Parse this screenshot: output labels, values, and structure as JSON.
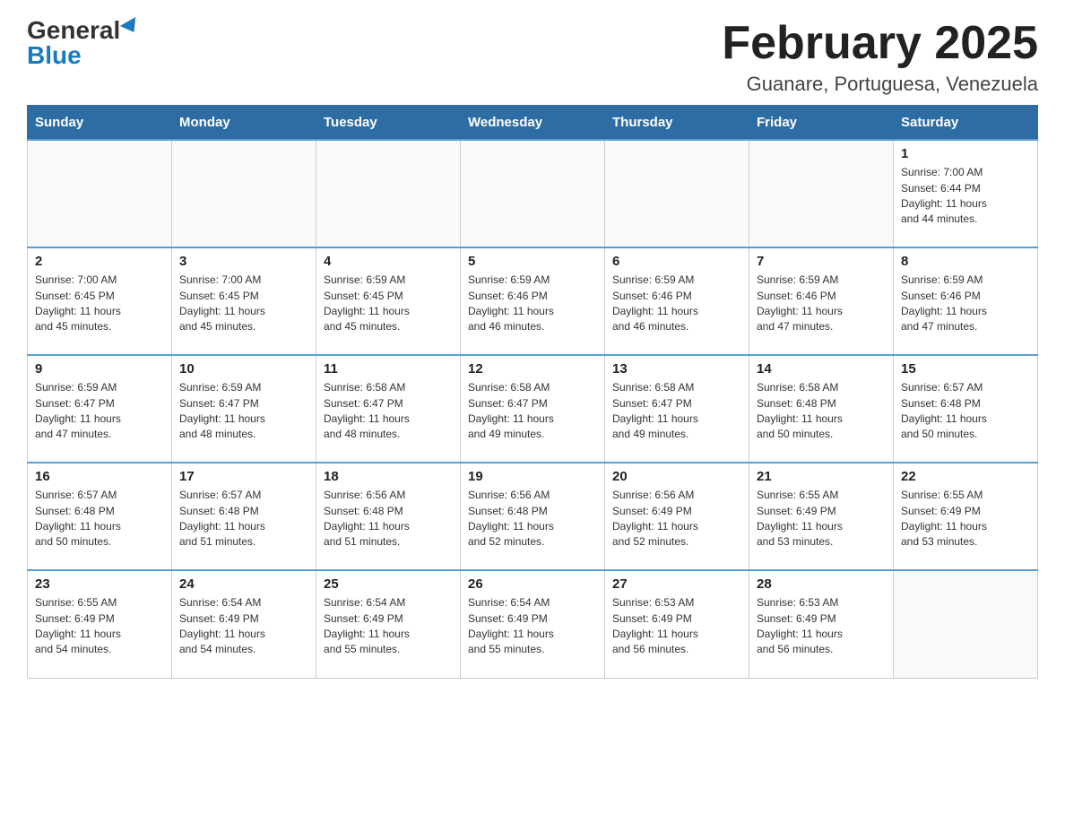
{
  "logo": {
    "general": "General",
    "blue": "Blue"
  },
  "header": {
    "month_title": "February 2025",
    "location": "Guanare, Portuguesa, Venezuela"
  },
  "weekdays": [
    "Sunday",
    "Monday",
    "Tuesday",
    "Wednesday",
    "Thursday",
    "Friday",
    "Saturday"
  ],
  "weeks": [
    [
      {
        "day": "",
        "info": ""
      },
      {
        "day": "",
        "info": ""
      },
      {
        "day": "",
        "info": ""
      },
      {
        "day": "",
        "info": ""
      },
      {
        "day": "",
        "info": ""
      },
      {
        "day": "",
        "info": ""
      },
      {
        "day": "1",
        "info": "Sunrise: 7:00 AM\nSunset: 6:44 PM\nDaylight: 11 hours\nand 44 minutes."
      }
    ],
    [
      {
        "day": "2",
        "info": "Sunrise: 7:00 AM\nSunset: 6:45 PM\nDaylight: 11 hours\nand 45 minutes."
      },
      {
        "day": "3",
        "info": "Sunrise: 7:00 AM\nSunset: 6:45 PM\nDaylight: 11 hours\nand 45 minutes."
      },
      {
        "day": "4",
        "info": "Sunrise: 6:59 AM\nSunset: 6:45 PM\nDaylight: 11 hours\nand 45 minutes."
      },
      {
        "day": "5",
        "info": "Sunrise: 6:59 AM\nSunset: 6:46 PM\nDaylight: 11 hours\nand 46 minutes."
      },
      {
        "day": "6",
        "info": "Sunrise: 6:59 AM\nSunset: 6:46 PM\nDaylight: 11 hours\nand 46 minutes."
      },
      {
        "day": "7",
        "info": "Sunrise: 6:59 AM\nSunset: 6:46 PM\nDaylight: 11 hours\nand 47 minutes."
      },
      {
        "day": "8",
        "info": "Sunrise: 6:59 AM\nSunset: 6:46 PM\nDaylight: 11 hours\nand 47 minutes."
      }
    ],
    [
      {
        "day": "9",
        "info": "Sunrise: 6:59 AM\nSunset: 6:47 PM\nDaylight: 11 hours\nand 47 minutes."
      },
      {
        "day": "10",
        "info": "Sunrise: 6:59 AM\nSunset: 6:47 PM\nDaylight: 11 hours\nand 48 minutes."
      },
      {
        "day": "11",
        "info": "Sunrise: 6:58 AM\nSunset: 6:47 PM\nDaylight: 11 hours\nand 48 minutes."
      },
      {
        "day": "12",
        "info": "Sunrise: 6:58 AM\nSunset: 6:47 PM\nDaylight: 11 hours\nand 49 minutes."
      },
      {
        "day": "13",
        "info": "Sunrise: 6:58 AM\nSunset: 6:47 PM\nDaylight: 11 hours\nand 49 minutes."
      },
      {
        "day": "14",
        "info": "Sunrise: 6:58 AM\nSunset: 6:48 PM\nDaylight: 11 hours\nand 50 minutes."
      },
      {
        "day": "15",
        "info": "Sunrise: 6:57 AM\nSunset: 6:48 PM\nDaylight: 11 hours\nand 50 minutes."
      }
    ],
    [
      {
        "day": "16",
        "info": "Sunrise: 6:57 AM\nSunset: 6:48 PM\nDaylight: 11 hours\nand 50 minutes."
      },
      {
        "day": "17",
        "info": "Sunrise: 6:57 AM\nSunset: 6:48 PM\nDaylight: 11 hours\nand 51 minutes."
      },
      {
        "day": "18",
        "info": "Sunrise: 6:56 AM\nSunset: 6:48 PM\nDaylight: 11 hours\nand 51 minutes."
      },
      {
        "day": "19",
        "info": "Sunrise: 6:56 AM\nSunset: 6:48 PM\nDaylight: 11 hours\nand 52 minutes."
      },
      {
        "day": "20",
        "info": "Sunrise: 6:56 AM\nSunset: 6:49 PM\nDaylight: 11 hours\nand 52 minutes."
      },
      {
        "day": "21",
        "info": "Sunrise: 6:55 AM\nSunset: 6:49 PM\nDaylight: 11 hours\nand 53 minutes."
      },
      {
        "day": "22",
        "info": "Sunrise: 6:55 AM\nSunset: 6:49 PM\nDaylight: 11 hours\nand 53 minutes."
      }
    ],
    [
      {
        "day": "23",
        "info": "Sunrise: 6:55 AM\nSunset: 6:49 PM\nDaylight: 11 hours\nand 54 minutes."
      },
      {
        "day": "24",
        "info": "Sunrise: 6:54 AM\nSunset: 6:49 PM\nDaylight: 11 hours\nand 54 minutes."
      },
      {
        "day": "25",
        "info": "Sunrise: 6:54 AM\nSunset: 6:49 PM\nDaylight: 11 hours\nand 55 minutes."
      },
      {
        "day": "26",
        "info": "Sunrise: 6:54 AM\nSunset: 6:49 PM\nDaylight: 11 hours\nand 55 minutes."
      },
      {
        "day": "27",
        "info": "Sunrise: 6:53 AM\nSunset: 6:49 PM\nDaylight: 11 hours\nand 56 minutes."
      },
      {
        "day": "28",
        "info": "Sunrise: 6:53 AM\nSunset: 6:49 PM\nDaylight: 11 hours\nand 56 minutes."
      },
      {
        "day": "",
        "info": ""
      }
    ]
  ]
}
